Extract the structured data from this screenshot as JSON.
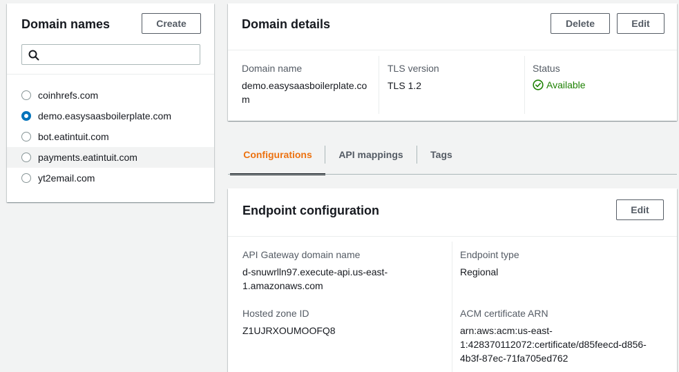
{
  "domain_names": {
    "title": "Domain names",
    "create_label": "Create",
    "search": {
      "value": "",
      "placeholder": ""
    },
    "items": [
      {
        "label": "coinhrefs.com",
        "selected": false
      },
      {
        "label": "demo.easysaasboilerplate.com",
        "selected": true
      },
      {
        "label": "bot.eatintuit.com",
        "selected": false
      },
      {
        "label": "payments.eatintuit.com",
        "selected": false
      },
      {
        "label": "yt2email.com",
        "selected": false
      }
    ]
  },
  "domain_details": {
    "title": "Domain details",
    "delete_label": "Delete",
    "edit_label": "Edit",
    "domain_name_label": "Domain name",
    "domain_name_line1": "demo.easysaasboilerplate.co",
    "domain_name_line2": "m",
    "tls_label": "TLS version",
    "tls_value": "TLS 1.2",
    "status_label": "Status",
    "status_value": "Available"
  },
  "tabs": [
    {
      "label": "Configurations",
      "active": true
    },
    {
      "label": "API mappings",
      "active": false
    },
    {
      "label": "Tags",
      "active": false
    }
  ],
  "endpoint_configuration": {
    "title": "Endpoint configuration",
    "edit_label": "Edit",
    "api_gateway_label": "API Gateway domain name",
    "api_gateway_line1": "d-snuwrlln97.execute-api.us-east-",
    "api_gateway_line2": "1.amazonaws.com",
    "endpoint_type_label": "Endpoint type",
    "endpoint_type_value": "Regional",
    "hosted_zone_label": "Hosted zone ID",
    "hosted_zone_value": "Z1UJRXOUMOOFQ8",
    "acm_label": "ACM certificate ARN",
    "acm_line1": "arn:aws:acm:us-east-",
    "acm_line2": "1:428370112072:certificate/d85feecd-d856-",
    "acm_line3": "4b3f-87ec-71fa705ed762"
  },
  "colors": {
    "accent": "#ec7211",
    "selected_radio": "#0073bb",
    "status_success": "#1d8102",
    "background": "#f2f3f3"
  },
  "icons": {
    "search": "search-icon",
    "status": "check-circle-icon"
  }
}
